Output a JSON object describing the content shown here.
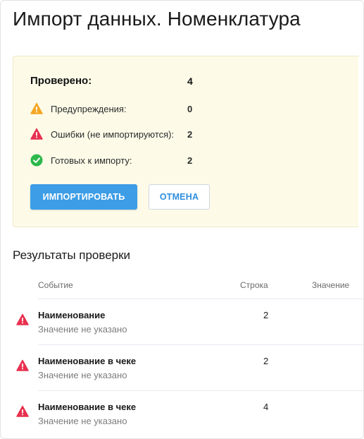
{
  "page": {
    "title": "Импорт данных. Номенклатура"
  },
  "summary": {
    "checked_label": "Проверено:",
    "checked_value": "4",
    "warnings_label": "Предупреждения:",
    "warnings_value": "0",
    "errors_label": "Ошибки (не импортируются):",
    "errors_value": "2",
    "ready_label": "Готовых к импорту:",
    "ready_value": "2",
    "import_button": "ИМПОРТИРОВАТЬ",
    "cancel_button": "ОТМЕНА"
  },
  "results": {
    "title": "Результаты проверки",
    "columns": {
      "event": "Событие",
      "row": "Строка",
      "value": "Значение"
    },
    "rows": [
      {
        "name": "Наименование",
        "message": "Значение не указано",
        "row": "2"
      },
      {
        "name": "Наименование в чеке",
        "message": "Значение не указано",
        "row": "2"
      },
      {
        "name": "Наименование в чеке",
        "message": "Значение не указано",
        "row": "4"
      }
    ]
  },
  "colors": {
    "accent": "#3d9de6",
    "warning": "#f5a623",
    "error": "#e8304f",
    "success": "#2db84b",
    "summary_bg": "#fdfbe8"
  },
  "icons": {
    "warning": "warning-triangle-icon",
    "error": "error-triangle-icon",
    "success": "check-circle-icon"
  }
}
